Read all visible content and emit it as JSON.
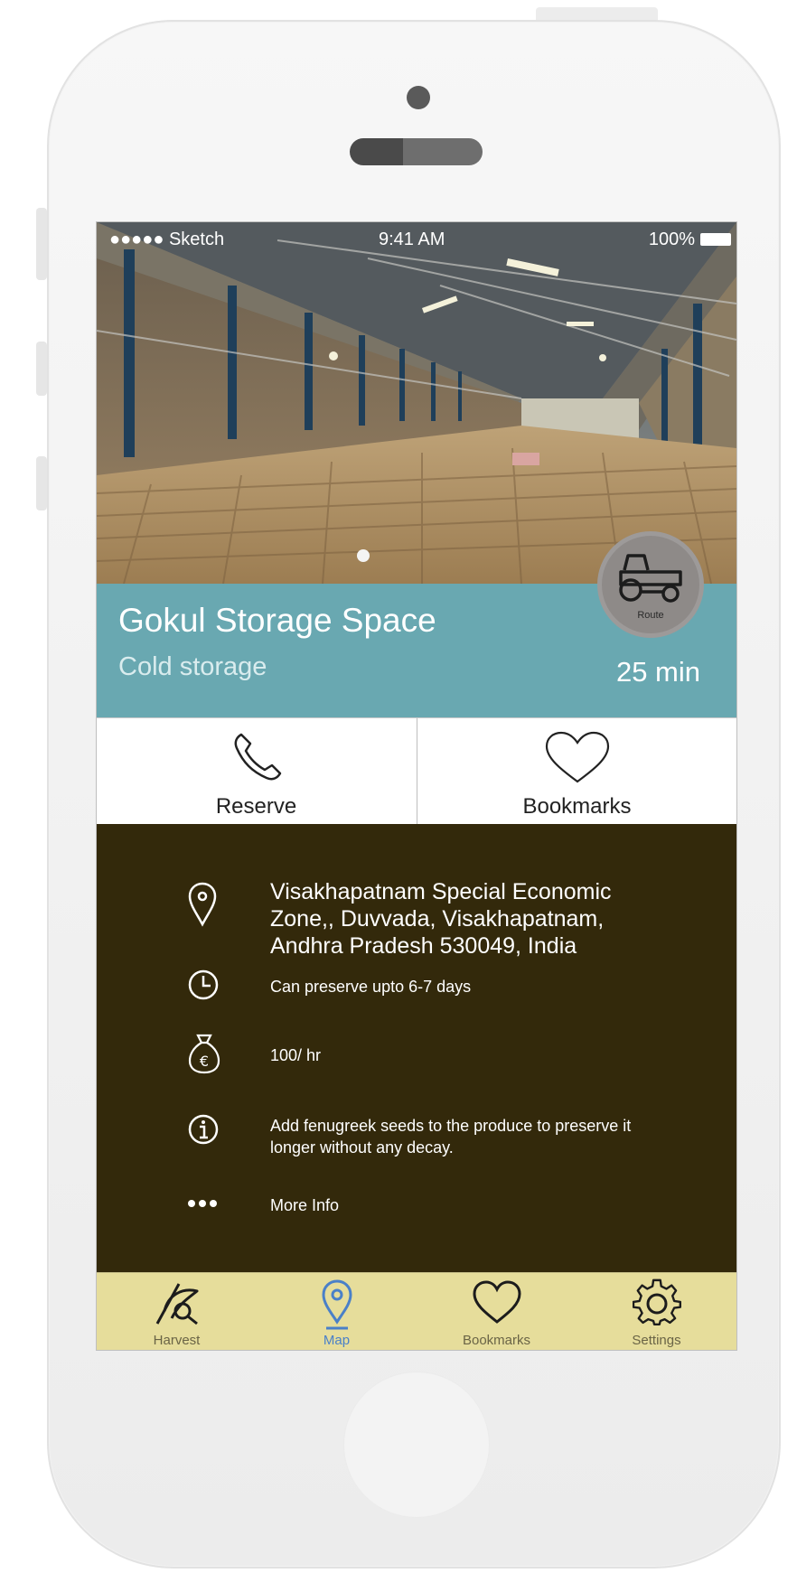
{
  "status_bar": {
    "carrier": "●●●●● Sketch",
    "time": "9:41 AM",
    "battery": "100%"
  },
  "place": {
    "name": "Gokul Storage Space",
    "category": "Cold storage",
    "eta": "25 min",
    "route_label": "Route"
  },
  "actions": {
    "reserve_label": "Reserve",
    "bookmarks_label": "Bookmarks"
  },
  "details": {
    "address": "Visakhapatnam Special Economic Zone,, Duvvada, Visakhapatnam, Andhra Pradesh 530049, India",
    "preserve": "Can preserve upto 6-7 days",
    "price": "100/ hr",
    "tip": "Add fenugreek seeds to the produce to preserve it longer without any decay.",
    "more_info": "More Info"
  },
  "tabs": [
    {
      "label": "Harvest",
      "icon": "harvest-icon"
    },
    {
      "label": "Map",
      "icon": "map-pin-icon"
    },
    {
      "label": "Bookmarks",
      "icon": "heart-icon"
    },
    {
      "label": "Settings",
      "icon": "gear-icon"
    }
  ],
  "colors": {
    "band": "#69a8b1",
    "details_bg": "#33290b",
    "tabbar_bg": "#e6dd9b",
    "active_tab": "#4a80c8"
  }
}
